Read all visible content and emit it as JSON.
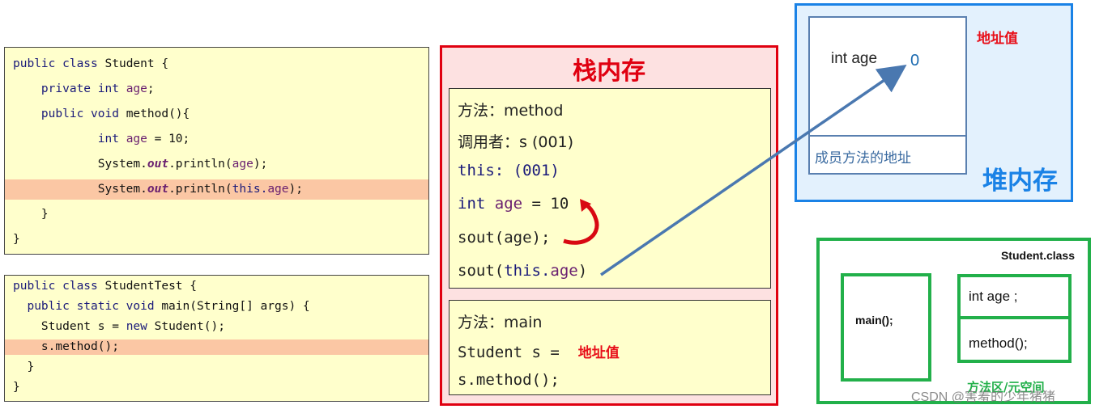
{
  "code_student": {
    "lines": [
      {
        "parts": [
          {
            "t": "public class ",
            "c": "kw"
          },
          {
            "t": "Student {",
            "c": ""
          }
        ]
      },
      {
        "parts": [
          {
            "t": "    private int ",
            "c": "kw"
          },
          {
            "t": "age",
            "c": "var"
          },
          {
            "t": ";",
            "c": ""
          }
        ]
      },
      {
        "parts": [
          {
            "t": "    public void ",
            "c": "kw"
          },
          {
            "t": "method(){",
            "c": ""
          }
        ]
      },
      {
        "parts": [
          {
            "t": "            int ",
            "c": "kw"
          },
          {
            "t": "age",
            "c": "var"
          },
          {
            "t": " = 10;",
            "c": ""
          }
        ]
      },
      {
        "parts": [
          {
            "t": "            System.",
            "c": ""
          },
          {
            "t": "out",
            "c": "it"
          },
          {
            "t": ".println(",
            "c": ""
          },
          {
            "t": "age",
            "c": "var"
          },
          {
            "t": ");",
            "c": ""
          }
        ]
      },
      {
        "parts": [
          {
            "t": "            System.",
            "c": ""
          },
          {
            "t": "out",
            "c": "it"
          },
          {
            "t": ".println(",
            "c": ""
          },
          {
            "t": "this.",
            "c": "kw"
          },
          {
            "t": "age",
            "c": "var"
          },
          {
            "t": ");",
            "c": ""
          }
        ],
        "highlight": true
      },
      {
        "parts": [
          {
            "t": "    }",
            "c": ""
          }
        ]
      },
      {
        "parts": [
          {
            "t": "}",
            "c": ""
          }
        ]
      }
    ]
  },
  "code_test": {
    "lines": [
      {
        "parts": [
          {
            "t": "public class ",
            "c": "kw"
          },
          {
            "t": "StudentTest {",
            "c": ""
          }
        ]
      },
      {
        "parts": [
          {
            "t": "  public static void ",
            "c": "kw"
          },
          {
            "t": "main(String[] args) {",
            "c": ""
          }
        ]
      },
      {
        "parts": [
          {
            "t": "    Student s = ",
            "c": ""
          },
          {
            "t": "new",
            "c": "kw"
          },
          {
            "t": " Student();",
            "c": ""
          }
        ]
      },
      {
        "parts": [
          {
            "t": "    s.method();",
            "c": ""
          }
        ],
        "highlight": true
      },
      {
        "parts": [
          {
            "t": "  }",
            "c": ""
          }
        ]
      },
      {
        "parts": [
          {
            "t": "}",
            "c": ""
          }
        ]
      }
    ]
  },
  "stack": {
    "title": "栈内存",
    "method_frame": {
      "method_label": "方法：method",
      "caller": "调用者：s (001)",
      "this_kw": "this:",
      "this_val": " (001)",
      "int_kw": "int ",
      "age_var": "age",
      "age_assign": " = 10",
      "sout_age": "sout(age);",
      "sout_this_pre": "sout(",
      "sout_this_kw": "this.",
      "sout_this_var": "age",
      "sout_this_post": ")"
    },
    "main_frame": {
      "method_label": "方法：main",
      "student_decl": "Student s = ",
      "address_label": "地址值",
      "call": "s.method();"
    }
  },
  "heap": {
    "title": "堆内存",
    "address_label": "地址值",
    "field_name": "int age",
    "field_value": "0",
    "method_address": "成员方法的地址"
  },
  "method_area": {
    "title": "方法区/元空间",
    "class_name": "Student.class",
    "main_method": "main();",
    "field": "int age ;",
    "method": "method();"
  },
  "watermark": "CSDN @害羞的少年猪猪",
  "colors": {
    "stack_red": "#e00010",
    "heap_blue": "#1a82e6",
    "method_green": "#22b04a",
    "arrow_blue": "#4a78b0",
    "highlight": "#fbc7a4",
    "code_bg": "#ffffcc"
  }
}
